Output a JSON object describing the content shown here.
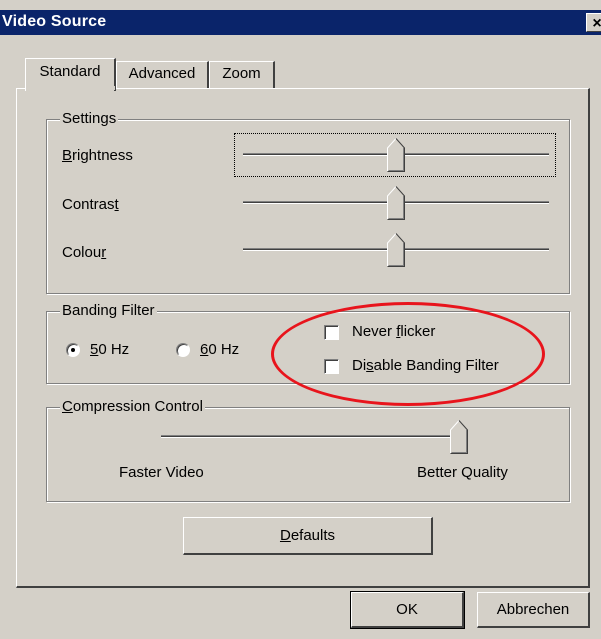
{
  "window": {
    "title": "Video Source",
    "close_glyph": "×"
  },
  "tabs": [
    {
      "label": "Standard",
      "active": true
    },
    {
      "label": "Advanced",
      "active": false
    },
    {
      "label": "Zoom",
      "active": false
    }
  ],
  "settings": {
    "group_label": "Settings",
    "sliders": [
      {
        "label": "Brightness",
        "underline_index": 0,
        "level_percent": 52
      },
      {
        "label": "Contrast",
        "underline_index": 6,
        "level_percent": 52
      },
      {
        "label": "Colour",
        "underline_index": 5,
        "level_percent": 52
      }
    ]
  },
  "banding": {
    "group_label": "Banding Filter",
    "radio_50_label": "50 Hz",
    "radio_60_label": "60 Hz",
    "selected": "50 Hz",
    "never_flicker_label": "Never flicker",
    "disable_label": "Disable Banding Filter",
    "never_flicker_checked": false,
    "disable_checked": false
  },
  "compression": {
    "group_label": "Compression Control",
    "left_label": "Faster Video",
    "right_label": "Better Quality",
    "level_percent": 100
  },
  "buttons": {
    "defaults": "Defaults",
    "ok": "OK",
    "cancel": "Abbrechen"
  },
  "annotation": {
    "color": "#e8141c"
  }
}
